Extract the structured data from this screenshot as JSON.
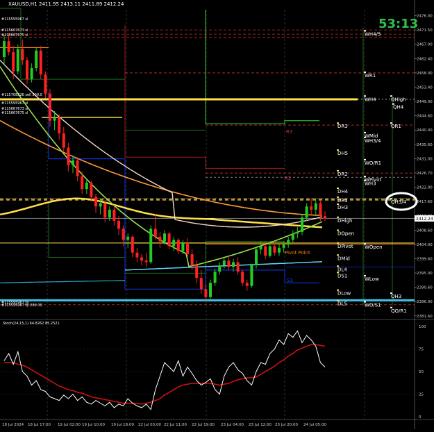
{
  "header": {
    "symbol": "XAUUSD,H1",
    "ohlc": "2411.95 2413.11 2411.89 2412.24",
    "countdown": "53:13"
  },
  "price_box": "2412.24",
  "order_labels": [
    {
      "text": "#115595967 sl"
    },
    {
      "text": "#115667673 sl"
    },
    {
      "text": "#115667675 sl"
    },
    {
      "text": "#115708326 sell 500.0"
    },
    {
      "text": "#115595967 sl"
    },
    {
      "text": "#115667673 sl"
    },
    {
      "text": "#115667675 sl"
    },
    {
      "text": "#115595967 tp"
    },
    {
      "text": "#115595967 tp 280.00"
    }
  ],
  "level_labels": [
    {
      "text": "WH4/5",
      "price": 2471
    },
    {
      "text": "WR1",
      "price": 2458
    },
    {
      "text": "WH4",
      "price": 2450.5
    },
    {
      "text": "QHigh",
      "price": 2450.5
    },
    {
      "text": "QH4",
      "price": 2448
    },
    {
      "text": "DR3",
      "price": 2442
    },
    {
      "text": "QR1",
      "price": 2442
    },
    {
      "text": "WMid",
      "price": 2439
    },
    {
      "text": "WH3/4",
      "price": 2437.5
    },
    {
      "text": "DH5",
      "price": 2433.5
    },
    {
      "text": "WO/R1",
      "price": 2430.5
    },
    {
      "text": "DR2",
      "price": 2427
    },
    {
      "text": "WPivot",
      "price": 2425.2
    },
    {
      "text": "WH3",
      "price": 2424
    },
    {
      "text": "DH4",
      "price": 2421.5
    },
    {
      "text": "DR1",
      "price": 2418.7
    },
    {
      "text": "QH3/4",
      "price": 2418.2
    },
    {
      "text": "DH3",
      "price": 2416.5
    },
    {
      "text": "DHigh",
      "price": 2412.4
    },
    {
      "text": "DOpen",
      "price": 2408.3
    },
    {
      "text": "DPivot",
      "price": 2404.3
    },
    {
      "text": "WOpen",
      "price": 2404
    },
    {
      "text": "DMid",
      "price": 2400.5
    },
    {
      "text": "DL4",
      "price": 2397
    },
    {
      "text": "DS1",
      "price": 2395
    },
    {
      "text": "WLow",
      "price": 2394
    },
    {
      "text": "DLow",
      "price": 2389.5
    },
    {
      "text": "QH3",
      "price": 2388.5
    },
    {
      "text": "DL5",
      "price": 2386.2
    },
    {
      "text": "WO/S1",
      "price": 2385.8
    },
    {
      "text": "QO/R1",
      "price": 2384
    }
  ],
  "chart_labels": {
    "r3": "R3",
    "r2": "R2",
    "pivot": "Pivot Point",
    "s1": "S1"
  },
  "stoch_title": "Stoch(24,15,1) 64.8262 85.2521",
  "chart_data": {
    "type": "line",
    "title": "XAUUSD,H1",
    "price_axis_ticks": [
      "2476.00",
      "2471.50",
      "2467.00",
      "2462.40",
      "2458.00",
      "2453.40",
      "2449.00",
      "2444.60",
      "2440.00",
      "2435.60",
      "2431.00",
      "2426.70",
      "2422.00",
      "2417.60",
      "2413.00",
      "2408.60",
      "2404.00",
      "2399.60",
      "2395.00",
      "2390.60",
      "2386.00",
      "2381.60"
    ],
    "price_ylim": [
      2380.9,
      2478.3
    ],
    "time_labels": [
      "18 Jul 2024",
      "18 Jul 17:00",
      "19 Jul 02:00",
      "19 Jul 10:00",
      "19 Jul 18:00",
      "22 Jul 03:00",
      "22 Jul 11:00",
      "22 Jul 19:00",
      "23 Jul 04:00",
      "23 Jul 12:00",
      "23 Jul 20:00",
      "24 Jul 05:00"
    ],
    "candles": [
      [
        2463.0,
        2470.0,
        2460.5,
        2468.0
      ],
      [
        2468.0,
        2470.5,
        2463.5,
        2464.5
      ],
      [
        2464.5,
        2466.5,
        2456.0,
        2458.5
      ],
      [
        2458.5,
        2467.0,
        2457.5,
        2465.5
      ],
      [
        2465.5,
        2468.5,
        2460.5,
        2462.0
      ],
      [
        2462.0,
        2463.0,
        2454.5,
        2456.0
      ],
      [
        2456.0,
        2461.0,
        2455.0,
        2459.5
      ],
      [
        2459.5,
        2466.0,
        2458.5,
        2465.0
      ],
      [
        2465.0,
        2466.5,
        2456.0,
        2457.5
      ],
      [
        2457.5,
        2458.5,
        2450.0,
        2451.5
      ],
      [
        2451.5,
        2453.0,
        2441.0,
        2443.0
      ],
      [
        2443.0,
        2446.0,
        2440.0,
        2444.0
      ],
      [
        2444.0,
        2445.0,
        2437.0,
        2439.0
      ],
      [
        2439.0,
        2441.0,
        2433.0,
        2434.5
      ],
      [
        2434.5,
        2436.0,
        2427.0,
        2429.0
      ],
      [
        2429.0,
        2432.0,
        2426.5,
        2430.5
      ],
      [
        2430.5,
        2431.5,
        2424.0,
        2425.5
      ],
      [
        2425.5,
        2427.0,
        2420.0,
        2421.5
      ],
      [
        2421.5,
        2424.5,
        2420.0,
        2423.5
      ],
      [
        2423.5,
        2424.0,
        2417.5,
        2419.0
      ],
      [
        2419.0,
        2420.0,
        2414.0,
        2416.0
      ],
      [
        2416.0,
        2418.5,
        2413.5,
        2417.0
      ],
      [
        2417.0,
        2418.0,
        2411.0,
        2412.5
      ],
      [
        2412.5,
        2416.0,
        2411.5,
        2415.0
      ],
      [
        2415.0,
        2416.5,
        2410.0,
        2411.5
      ],
      [
        2411.5,
        2413.0,
        2407.0,
        2409.0
      ],
      [
        2409.0,
        2410.0,
        2403.5,
        2405.5
      ],
      [
        2405.5,
        2407.5,
        2403.0,
        2406.5
      ],
      [
        2406.5,
        2407.0,
        2400.0,
        2401.5
      ],
      [
        2401.5,
        2403.0,
        2398.5,
        2400.0
      ],
      [
        2400.0,
        2401.0,
        2397.5,
        2399.0
      ],
      [
        2399.0,
        2401.5,
        2397.0,
        2398.5
      ],
      [
        2398.5,
        2410.0,
        2398.0,
        2409.0
      ],
      [
        2409.0,
        2413.5,
        2405.5,
        2406.5
      ],
      [
        2406.5,
        2408.0,
        2403.0,
        2405.0
      ],
      [
        2405.0,
        2408.5,
        2404.0,
        2407.5
      ],
      [
        2407.5,
        2408.0,
        2402.5,
        2403.5
      ],
      [
        2403.5,
        2406.5,
        2402.0,
        2405.5
      ],
      [
        2405.5,
        2406.0,
        2401.0,
        2402.0
      ],
      [
        2402.0,
        2405.5,
        2401.0,
        2404.5
      ],
      [
        2404.5,
        2406.0,
        2400.0,
        2401.0
      ],
      [
        2401.0,
        2402.5,
        2396.0,
        2397.5
      ],
      [
        2397.5,
        2399.0,
        2392.0,
        2393.5
      ],
      [
        2393.5,
        2396.0,
        2388.5,
        2390.0
      ],
      [
        2390.0,
        2391.5,
        2386.0,
        2387.5
      ],
      [
        2387.5,
        2393.0,
        2387.0,
        2392.0
      ],
      [
        2392.0,
        2396.5,
        2391.0,
        2395.5
      ],
      [
        2395.5,
        2398.5,
        2394.5,
        2397.5
      ],
      [
        2397.5,
        2400.0,
        2396.5,
        2399.0
      ],
      [
        2399.0,
        2400.5,
        2396.0,
        2397.0
      ],
      [
        2397.0,
        2399.5,
        2395.5,
        2398.5
      ],
      [
        2398.5,
        2400.0,
        2394.5,
        2395.5
      ],
      [
        2395.5,
        2396.0,
        2391.0,
        2392.0
      ],
      [
        2392.0,
        2393.0,
        2389.5,
        2391.0
      ],
      [
        2391.0,
        2398.0,
        2390.5,
        2397.5
      ],
      [
        2397.5,
        2403.5,
        2396.5,
        2402.5
      ],
      [
        2402.5,
        2405.0,
        2401.0,
        2403.5
      ],
      [
        2403.5,
        2404.0,
        2399.5,
        2400.5
      ],
      [
        2400.5,
        2404.5,
        2400.0,
        2403.5
      ],
      [
        2403.5,
        2404.5,
        2400.5,
        2401.5
      ],
      [
        2401.5,
        2404.5,
        2400.5,
        2403.0
      ],
      [
        2403.0,
        2405.0,
        2401.5,
        2404.0
      ],
      [
        2404.0,
        2406.5,
        2403.0,
        2405.5
      ],
      [
        2405.5,
        2408.5,
        2404.5,
        2407.5
      ],
      [
        2407.5,
        2409.5,
        2406.0,
        2408.0
      ],
      [
        2408.0,
        2413.5,
        2407.0,
        2412.5
      ],
      [
        2412.5,
        2417.0,
        2411.5,
        2416.0
      ],
      [
        2416.0,
        2418.5,
        2413.5,
        2415.0
      ],
      [
        2415.0,
        2418.0,
        2413.0,
        2417.0
      ],
      [
        2417.0,
        2418.0,
        2411.5,
        2413.0
      ],
      [
        2413.0,
        2414.5,
        2411.5,
        2412.2
      ]
    ],
    "stoch": {
      "ylim": [
        0,
        100
      ],
      "ticks": [
        "100",
        "75",
        "50",
        "25",
        "0"
      ],
      "main": [
        62,
        70,
        58,
        72,
        50,
        45,
        35,
        40,
        30,
        28,
        22,
        20,
        18,
        24,
        20,
        25,
        18,
        22,
        16,
        14,
        18,
        15,
        12,
        16,
        10,
        14,
        12,
        20,
        15,
        12,
        10,
        14,
        8,
        30,
        45,
        60,
        55,
        50,
        62,
        45,
        55,
        48,
        40,
        35,
        38,
        42,
        30,
        25,
        45,
        55,
        60,
        52,
        48,
        40,
        35,
        50,
        60,
        58,
        70,
        75,
        85,
        80,
        92,
        88,
        95,
        82,
        90,
        85,
        78,
        60,
        55
      ],
      "signal": [
        60,
        60,
        60,
        58,
        57,
        55,
        52,
        49,
        46,
        43,
        40,
        37,
        34,
        32,
        30,
        29,
        27,
        26,
        24,
        22,
        21,
        20,
        19,
        18,
        17,
        16,
        15,
        15,
        15,
        15,
        14,
        15,
        16,
        18,
        20,
        24,
        27,
        30,
        33,
        35,
        36,
        37,
        37,
        37,
        37,
        37,
        36,
        35,
        36,
        37,
        39,
        41,
        42,
        43,
        43,
        44,
        47,
        50,
        53,
        56,
        60,
        63,
        67,
        70,
        74,
        76,
        78,
        80,
        80,
        79,
        78
      ]
    }
  }
}
